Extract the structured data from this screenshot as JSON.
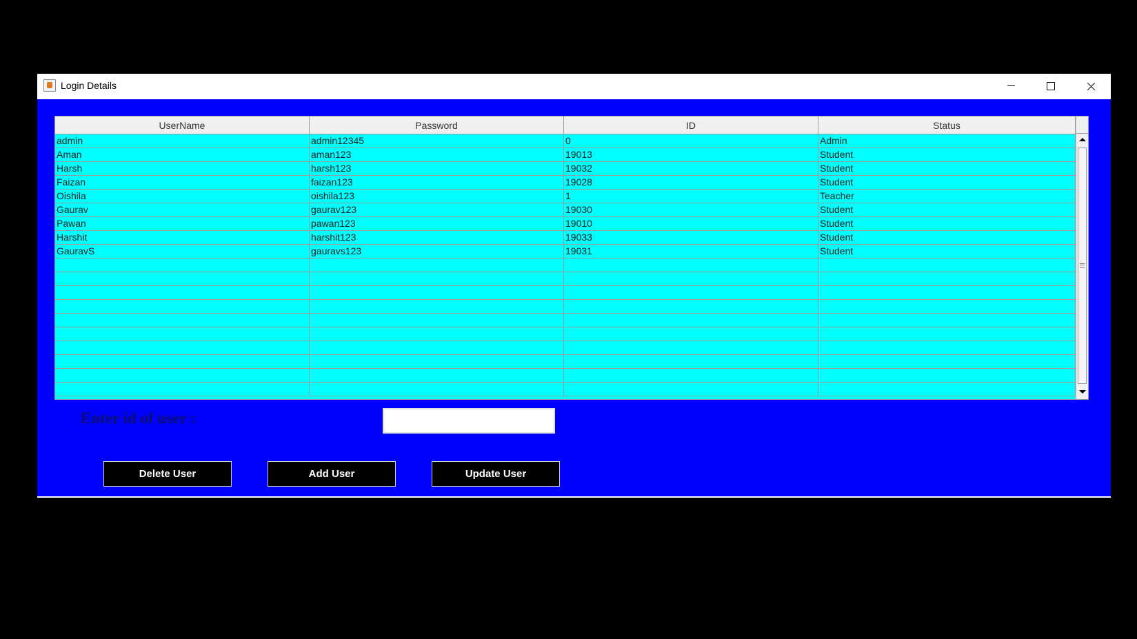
{
  "window": {
    "title": "Login Details",
    "controls": [
      "minimize-icon",
      "maximize-icon",
      "close-icon"
    ],
    "background_color": "#0000ff"
  },
  "table": {
    "columns": [
      "UserName",
      "Password",
      "ID",
      "Status"
    ],
    "rows": [
      [
        "admin",
        "admin12345",
        "0",
        "Admin"
      ],
      [
        "Aman",
        "aman123",
        "19013",
        "Student"
      ],
      [
        "Harsh",
        "harsh123",
        "19032",
        "Student"
      ],
      [
        "Faizan",
        "faizan123",
        "19028",
        "Student"
      ],
      [
        "Oishila",
        "oishila123",
        "1",
        "Teacher"
      ],
      [
        "Gaurav",
        "gaurav123",
        "19030",
        "Student"
      ],
      [
        "Pawan",
        "pawan123",
        "19010",
        "Student"
      ],
      [
        "Harshit",
        "harshit123",
        "19033",
        "Student"
      ],
      [
        "GauravS",
        "gauravs123",
        "19031",
        "Student"
      ],
      [
        "",
        "",
        "",
        ""
      ],
      [
        "",
        "",
        "",
        ""
      ],
      [
        "",
        "",
        "",
        ""
      ],
      [
        "",
        "",
        "",
        ""
      ],
      [
        "",
        "",
        "",
        ""
      ],
      [
        "",
        "",
        "",
        ""
      ],
      [
        "",
        "",
        "",
        ""
      ],
      [
        "",
        "",
        "",
        ""
      ],
      [
        "",
        "",
        "",
        ""
      ],
      [
        "",
        "",
        "",
        ""
      ]
    ],
    "row_color": "#00ffff"
  },
  "form": {
    "id_label": "Enter id of user :",
    "id_value": "",
    "id_placeholder": ""
  },
  "buttons": {
    "delete": "Delete User",
    "add": "Add User",
    "update": "Update User"
  }
}
